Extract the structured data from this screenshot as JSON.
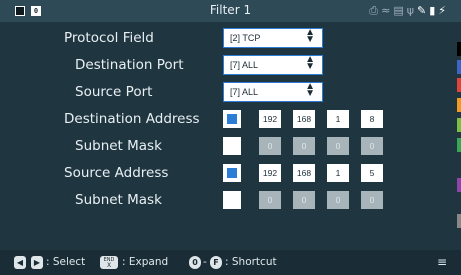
{
  "header": {
    "window_icon_label": "0",
    "title": "Filter 1",
    "status_icons": [
      "printer-icon",
      "wifi-icon",
      "network-icon",
      "usb-icon",
      "pen-icon",
      "battery-icon",
      "power-icon"
    ]
  },
  "fields": [
    {
      "label": "Protocol Field",
      "type": "select",
      "value": "[2] TCP"
    },
    {
      "label": "Destination Port",
      "type": "select",
      "value": "[7] ALL"
    },
    {
      "label": "Source Port",
      "type": "select",
      "value": "[7] ALL"
    },
    {
      "label": "Destination Address",
      "type": "address",
      "checked": true,
      "octets": [
        "192",
        "168",
        "1",
        "8"
      ]
    },
    {
      "label": "Subnet Mask",
      "type": "address",
      "checked": false,
      "octets": [
        "0",
        "0",
        "0",
        "0"
      ]
    },
    {
      "label": "Source Address",
      "type": "address",
      "checked": true,
      "octets": [
        "192",
        "168",
        "1",
        "5"
      ]
    },
    {
      "label": "Subnet Mask",
      "type": "address",
      "checked": false,
      "octets": [
        "0",
        "0",
        "0",
        "0"
      ]
    }
  ],
  "footer": {
    "select_label": ": Select",
    "expand_key_top": "END",
    "expand_key_bottom": "X",
    "expand_label": ": Expand",
    "shortcut_key_start": "0",
    "shortcut_key_end": "F",
    "shortcut_label": ": Shortcut"
  },
  "colors": {
    "background": "#1f3540",
    "accent": "#2b7dd6",
    "side_strip": [
      "#000000",
      "#3a66c8",
      "#e0453a",
      "#f29b1f",
      "#7ac143",
      "#35a853",
      "#8e44ad",
      "#888888"
    ]
  }
}
